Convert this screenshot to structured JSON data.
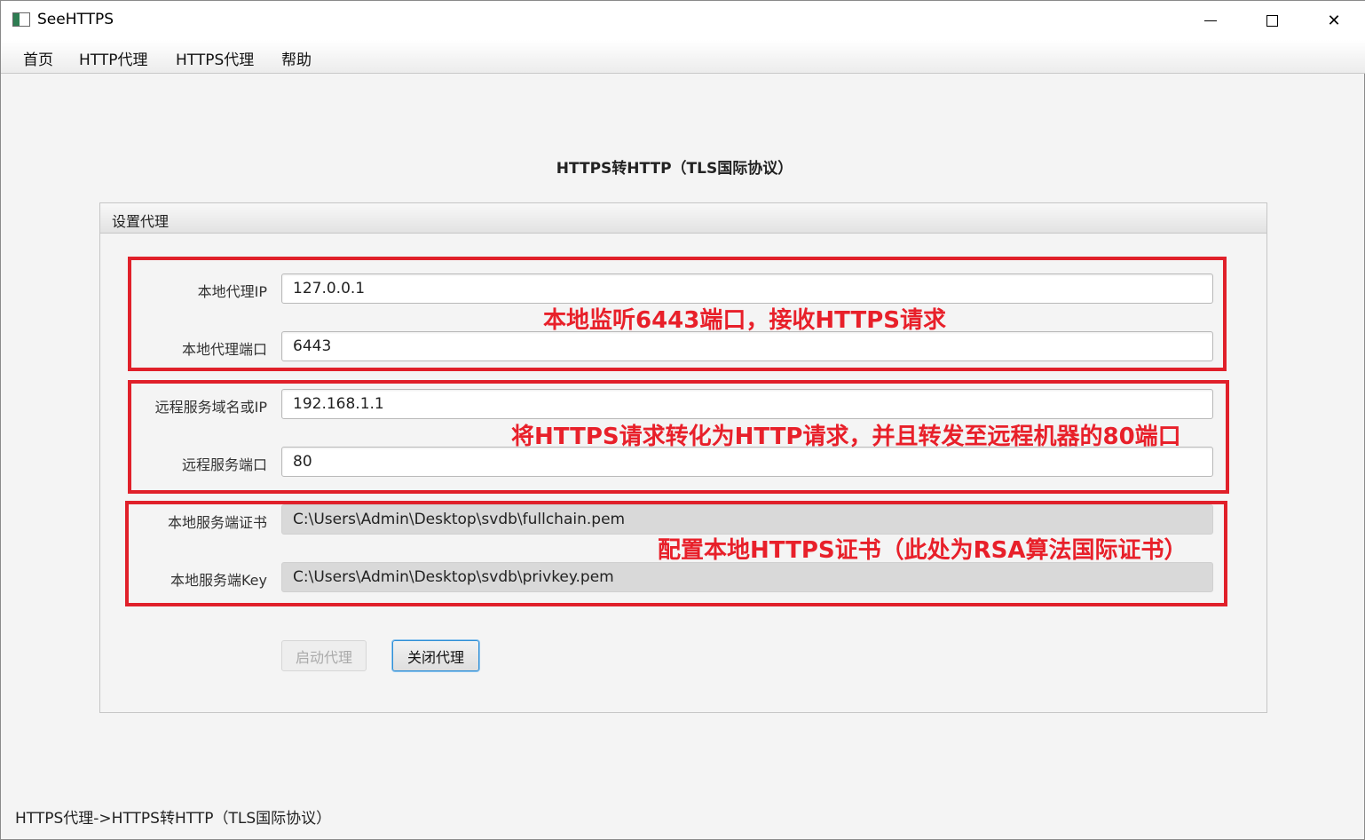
{
  "window": {
    "title": "SeeHTTPS"
  },
  "menu": [
    "首页",
    "HTTP代理",
    "HTTPS代理",
    "帮助"
  ],
  "page": {
    "title": "HTTPS转HTTP（TLS国际协议）"
  },
  "group": {
    "title": "设置代理"
  },
  "fields": {
    "local_ip": {
      "label": "本地代理IP",
      "value": "127.0.0.1"
    },
    "local_port": {
      "label": "本地代理端口",
      "value": "6443"
    },
    "remote_host": {
      "label": "远程服务域名或IP",
      "value": "192.168.1.1"
    },
    "remote_port": {
      "label": "远程服务端口",
      "value": "80"
    },
    "cert": {
      "label": "本地服务端证书",
      "value": "C:\\Users\\Admin\\Desktop\\svdb\\fullchain.pem"
    },
    "key": {
      "label": "本地服务端Key",
      "value": "C:\\Users\\Admin\\Desktop\\svdb\\privkey.pem"
    }
  },
  "annotations": {
    "listen": "本地监听6443端口，接收HTTPS请求",
    "forward": "将HTTPS请求转化为HTTP请求，并且转发至远程机器的80端口",
    "cert": "配置本地HTTPS证书（此处为RSA算法国际证书）"
  },
  "buttons": {
    "start": "启动代理",
    "stop": "关闭代理"
  },
  "status": "HTTPS代理->HTTPS转HTTP（TLS国际协议）",
  "colors": {
    "annotation": "#e8202a",
    "focus": "#2f8fd6"
  }
}
